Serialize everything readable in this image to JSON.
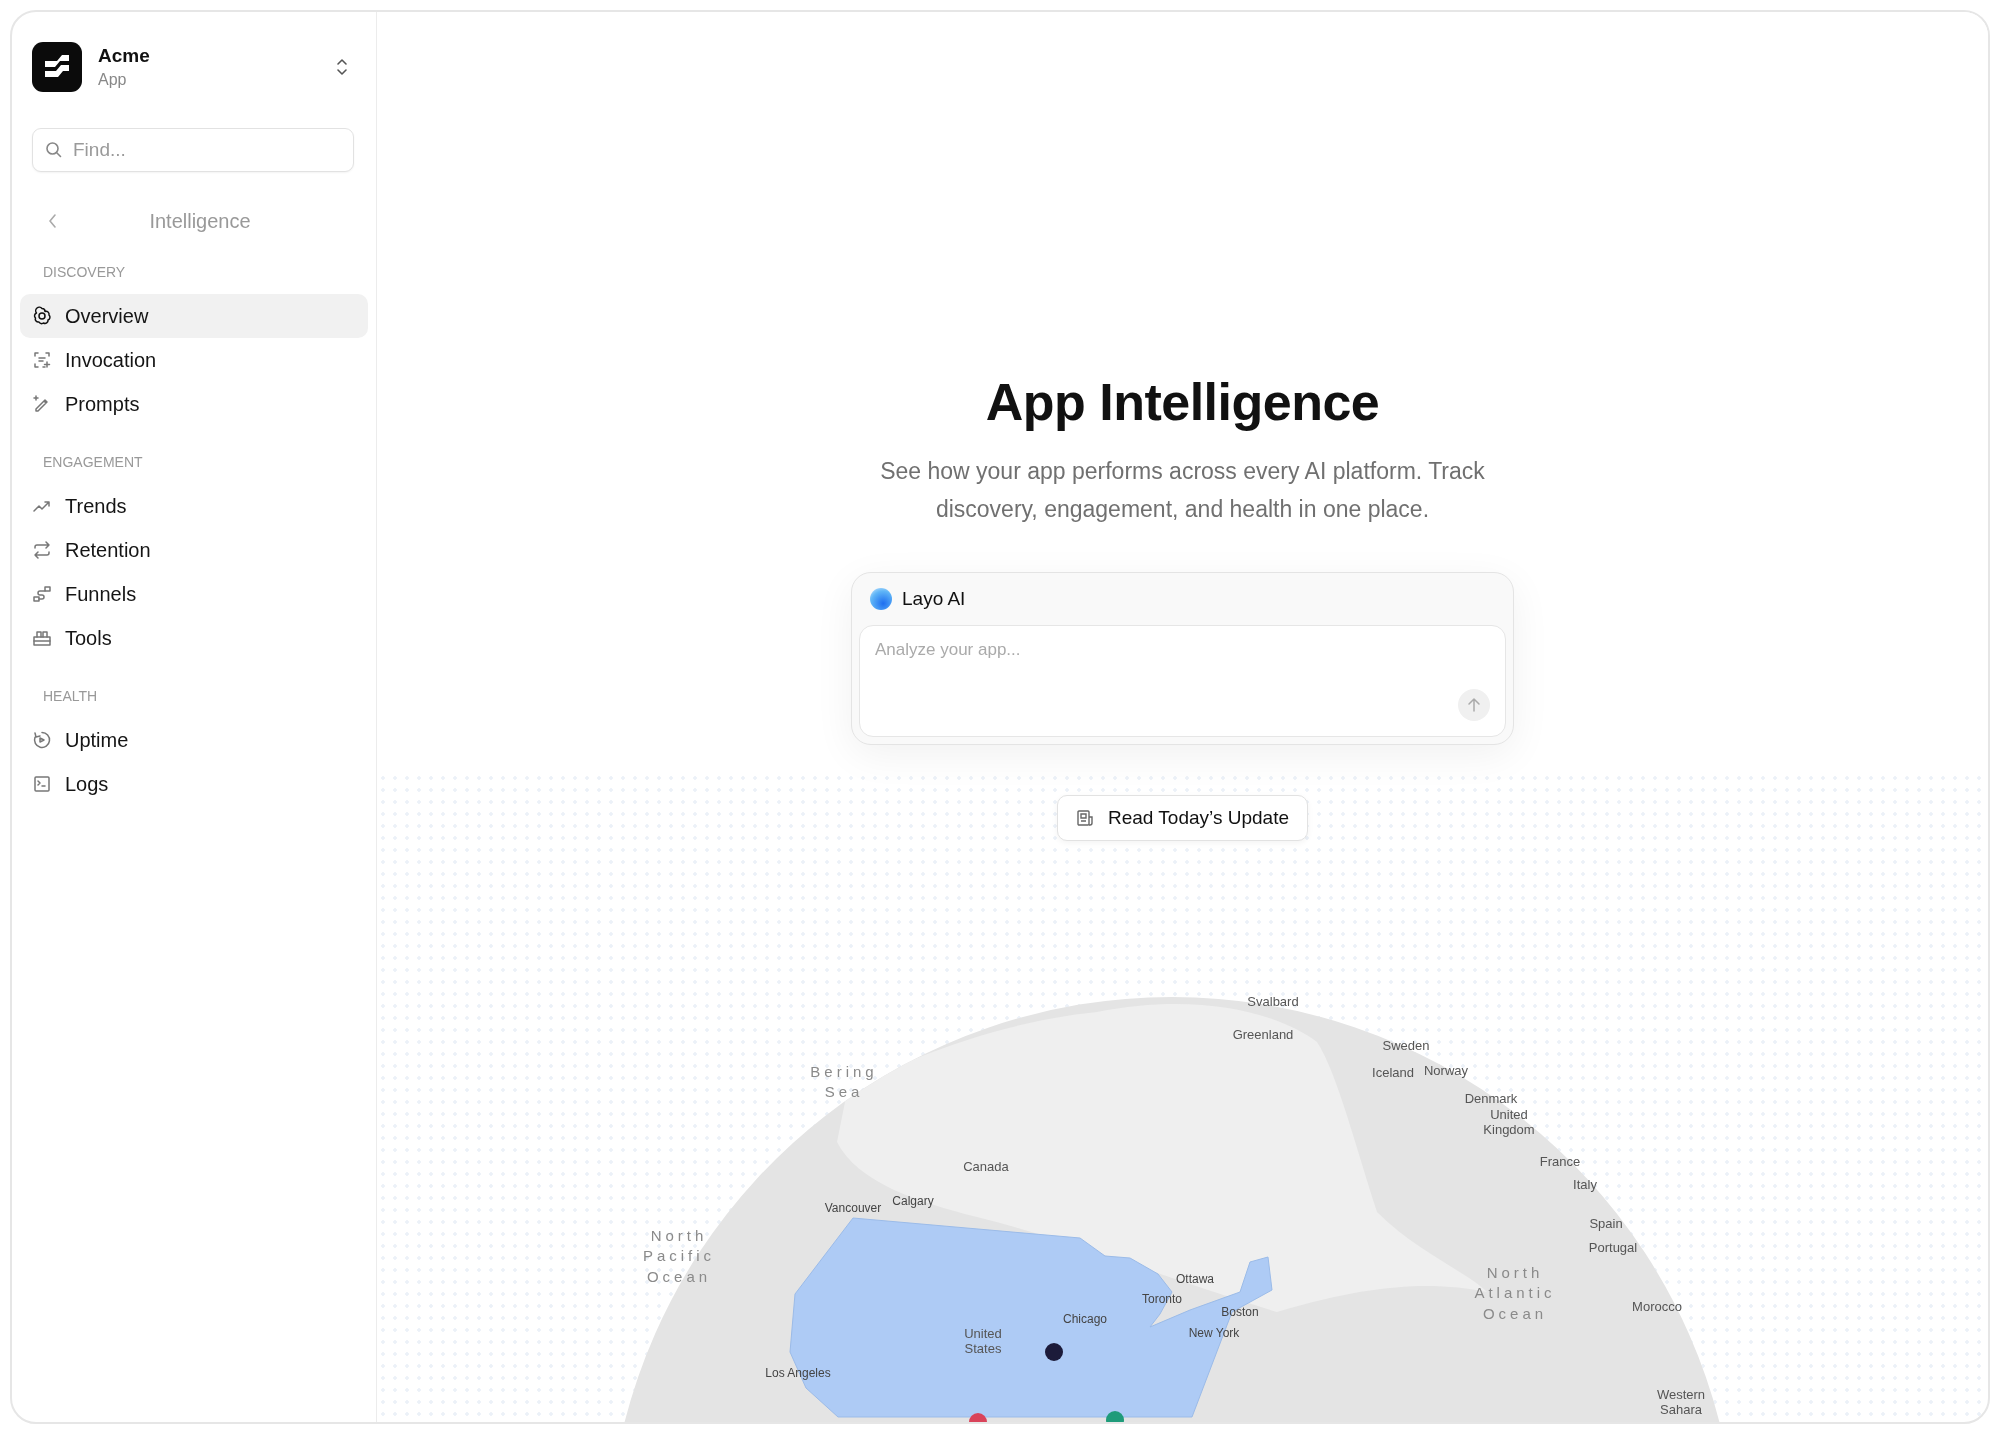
{
  "workspace": {
    "name": "Acme",
    "subtitle": "App"
  },
  "search": {
    "placeholder": "Find..."
  },
  "nav": {
    "title": "Intelligence"
  },
  "sections": [
    {
      "heading": "DISCOVERY",
      "items": [
        {
          "label": "Overview",
          "kind": "flower",
          "selected": true
        },
        {
          "label": "Invocation",
          "kind": "scan",
          "selected": false
        },
        {
          "label": "Prompts",
          "kind": "pencil",
          "selected": false
        }
      ]
    },
    {
      "heading": "ENGAGEMENT",
      "items": [
        {
          "label": "Trends",
          "kind": "trend",
          "selected": false
        },
        {
          "label": "Retention",
          "kind": "repeat",
          "selected": false
        },
        {
          "label": "Funnels",
          "kind": "steps",
          "selected": false
        },
        {
          "label": "Tools",
          "kind": "toolbox",
          "selected": false
        }
      ]
    },
    {
      "heading": "HEALTH",
      "items": [
        {
          "label": "Uptime",
          "kind": "timer",
          "selected": false
        },
        {
          "label": "Logs",
          "kind": "terminal",
          "selected": false
        }
      ]
    }
  ],
  "hero": {
    "title": "App Intelligence",
    "subtitle": "See how your app performs across every AI platform. Track discovery, engagement, and health in one place."
  },
  "assistant": {
    "name": "Layo AI",
    "placeholder": "Analyze your app..."
  },
  "update_button": {
    "label": "Read Today’s Update"
  },
  "map": {
    "labels": [
      {
        "text": "Svalbard",
        "kind": "country"
      },
      {
        "text": "Greenland",
        "kind": "country"
      },
      {
        "text": "Sweden",
        "kind": "country"
      },
      {
        "text": "Bering Sea",
        "kind": "ocean"
      },
      {
        "text": "Iceland",
        "kind": "country"
      },
      {
        "text": "Norway",
        "kind": "country"
      },
      {
        "text": "Denmark",
        "kind": "country"
      },
      {
        "text": "United Kingdom",
        "kind": "country"
      },
      {
        "text": "France",
        "kind": "country"
      },
      {
        "text": "Canada",
        "kind": "country"
      },
      {
        "text": "Italy",
        "kind": "country"
      },
      {
        "text": "Vancouver",
        "kind": "city"
      },
      {
        "text": "Calgary",
        "kind": "city"
      },
      {
        "text": "North Pacific Ocean",
        "kind": "ocean"
      },
      {
        "text": "Spain",
        "kind": "country"
      },
      {
        "text": "Portugal",
        "kind": "country"
      },
      {
        "text": "Ottawa",
        "kind": "city"
      },
      {
        "text": "Toronto",
        "kind": "city"
      },
      {
        "text": "Boston",
        "kind": "city"
      },
      {
        "text": "Chicago",
        "kind": "city"
      },
      {
        "text": "North Atlantic Ocean",
        "kind": "ocean"
      },
      {
        "text": "Morocco",
        "kind": "country"
      },
      {
        "text": "United States",
        "kind": "country"
      },
      {
        "text": "New York",
        "kind": "city"
      },
      {
        "text": "Los Angeles",
        "kind": "city"
      },
      {
        "text": "Western Sahara",
        "kind": "country"
      }
    ],
    "markers": [
      {
        "color": "#1c1b3a"
      },
      {
        "color": "#d9435a"
      },
      {
        "color": "#1f9b7a"
      }
    ]
  }
}
